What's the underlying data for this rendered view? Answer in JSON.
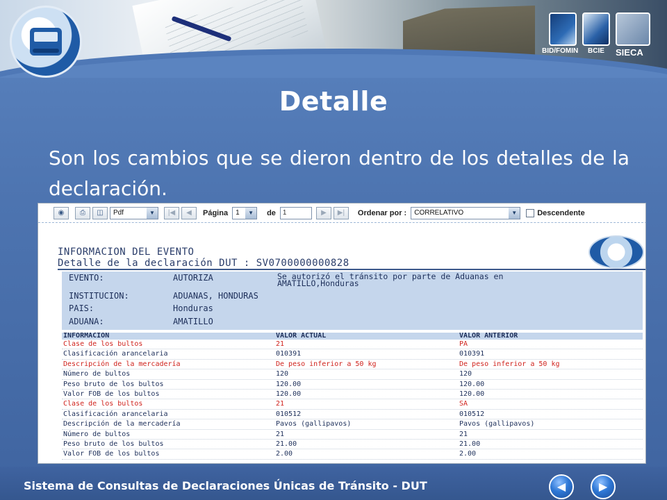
{
  "slide": {
    "title": "Detalle",
    "body": "Son los cambios que se dieron dentro de los detalles de la declaración.",
    "footer": "Sistema de Consultas de Declaraciones Únicas de Tránsito - DUT",
    "sponsors": [
      "BID/FOMIN",
      "BCIE",
      "SIECA"
    ]
  },
  "toolbar": {
    "format": "Pdf",
    "page_label": "Página",
    "page_value": "1",
    "of_label": "de",
    "total_pages": "1",
    "sort_label": "Ordenar por :",
    "sort_value": "CORRELATIVO",
    "desc_label": "Descendente",
    "icons": [
      "binoculars-icon",
      "print-icon",
      "export-icon",
      "first-page-icon",
      "prev-page-icon",
      "next-page-icon",
      "last-page-icon"
    ]
  },
  "report": {
    "heading1": "INFORMACION DEL EVENTO",
    "heading2": "Detalle de la declaración DUT : SV0700000000828",
    "event_label": "EVENTO:",
    "event_value": "AUTORIZA",
    "event_note_1": "Se autorizó el tránsito por parte de Aduanas en",
    "event_note_2": "AMATILLO,Honduras",
    "institution_label": "INSTITUCION:",
    "institution_value": "ADUANAS, HONDURAS",
    "country_label": "PAIS:",
    "country_value": "Honduras",
    "customs_label": "ADUANA:",
    "customs_value": "AMATILLO",
    "columns": {
      "info": "INFORMACION",
      "current": "VALOR ACTUAL",
      "previous": "VALOR ANTERIOR"
    },
    "rows": [
      {
        "info": "Clase de los bultos",
        "current": "21",
        "previous": "PA",
        "changed": true
      },
      {
        "info": "Clasificación arancelaria",
        "current": "010391",
        "previous": "010391",
        "changed": false
      },
      {
        "info": "Descripción de la mercadería",
        "current": "De peso inferior a 50 kg",
        "previous": "De peso inferior a 50 kg",
        "changed": true
      },
      {
        "info": "Número de bultos",
        "current": "120",
        "previous": "120",
        "changed": false
      },
      {
        "info": "Peso bruto de los bultos",
        "current": "120.00",
        "previous": "120.00",
        "changed": false
      },
      {
        "info": "Valor FOB de los bultos",
        "current": "120.00",
        "previous": "120.00",
        "changed": false
      },
      {
        "info": "Clase de los bultos",
        "current": "21",
        "previous": "SA",
        "changed": true
      },
      {
        "info": "Clasificación arancelaria",
        "current": "010512",
        "previous": "010512",
        "changed": false
      },
      {
        "info": "Descripción de la mercadería",
        "current": "Pavos (gallipavos)",
        "previous": "Pavos (gallipavos)",
        "changed": false
      },
      {
        "info": "Número de bultos",
        "current": "21",
        "previous": "21",
        "changed": false
      },
      {
        "info": "Peso bruto de los bultos",
        "current": "21.00",
        "previous": "21.00",
        "changed": false
      },
      {
        "info": "Valor FOB de los bultos",
        "current": "2.00",
        "previous": "2.00",
        "changed": false
      }
    ]
  },
  "colors": {
    "slide_blue": "#4d74b0",
    "changed_red": "#d0231d",
    "report_text": "#1d2f5a",
    "info_bg": "#c5d6ec"
  }
}
